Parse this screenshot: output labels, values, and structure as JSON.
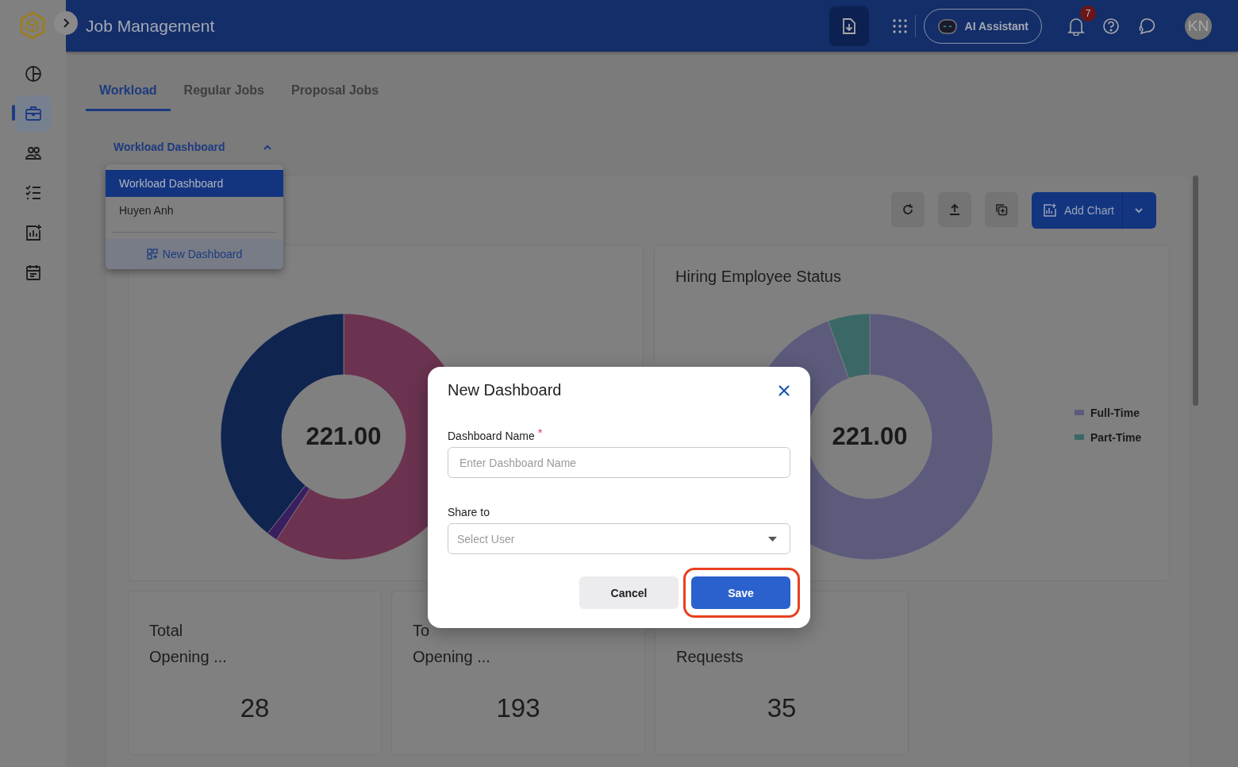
{
  "app": {
    "title": "Job Management"
  },
  "sidebar": {
    "items": [
      {
        "kind": "pie",
        "selected": false
      },
      {
        "kind": "briefcase",
        "selected": true
      },
      {
        "kind": "people",
        "selected": false
      },
      {
        "kind": "checklist",
        "selected": false
      },
      {
        "kind": "chart-add",
        "selected": false
      },
      {
        "kind": "calendar",
        "selected": false
      }
    ]
  },
  "header": {
    "ai_button": "AI Assistant",
    "notification_count": "7",
    "avatar": "KN"
  },
  "tabs": [
    {
      "label": "Workload",
      "selected": true
    },
    {
      "label": "Regular Jobs",
      "selected": false
    },
    {
      "label": "Proposal Jobs",
      "selected": false
    }
  ],
  "dashboard_select": {
    "value": "Workload Dashboard",
    "expanded": true
  },
  "dashboard_menu": {
    "items": [
      {
        "label": "Workload Dashboard",
        "selected": true
      },
      {
        "label": "Huyen Anh",
        "selected": false
      }
    ],
    "action": "New Dashboard"
  },
  "toolbar": {
    "add_chart": "Add Chart"
  },
  "charts": [
    {
      "kind": "priority",
      "center": "221.00"
    },
    {
      "kind": "status",
      "title": "Hiring Employee Status",
      "center": "221.00",
      "legend": [
        {
          "label": "Full-Time",
          "color": "#5c5b7c"
        },
        {
          "label": "Part-Time",
          "color": "#3b6866"
        }
      ]
    }
  ],
  "stats": [
    {
      "title_lines": [
        "Total",
        "Opening ..."
      ],
      "value": "28"
    },
    {
      "title_lines": [
        "To",
        "Opening ..."
      ],
      "value": "193"
    },
    {
      "title_lines": [
        "Requests"
      ],
      "value": "35"
    }
  ],
  "modal": {
    "title": "New Dashboard",
    "fields": [
      {
        "kind": "text",
        "label": "Dashboard Name",
        "required_mark": "*",
        "placeholder": "Enter Dashboard Name"
      },
      {
        "kind": "select",
        "label": "Share to",
        "placeholder": "Select User"
      }
    ],
    "buttons": [
      {
        "kind": "secondary",
        "label": "Cancel",
        "highlighted": false
      },
      {
        "kind": "primary",
        "label": "Save",
        "highlighted": true
      }
    ]
  }
}
